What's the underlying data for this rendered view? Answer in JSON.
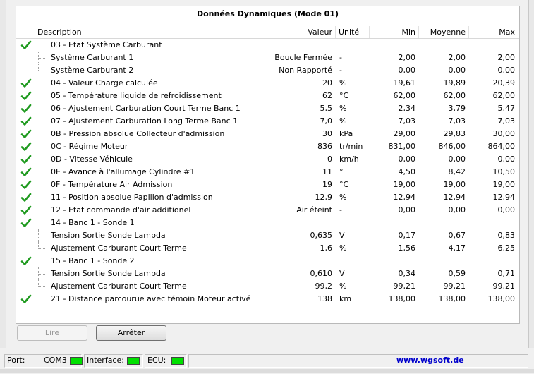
{
  "panel": {
    "title": "Données Dynamiques (Mode 01)"
  },
  "columns": {
    "description": "Description",
    "valeur": "Valeur",
    "unite": "Unité",
    "min": "Min",
    "moyenne": "Moyenne",
    "max": "Max"
  },
  "rows": [
    {
      "desc": "03 - Etat Système Carburant",
      "val": "",
      "unit": "",
      "min": "",
      "moy": "",
      "max": "",
      "check": true,
      "child": false
    },
    {
      "desc": "Système Carburant 1",
      "val": "Boucle Fermée",
      "unit": "-",
      "min": "2,00",
      "moy": "2,00",
      "max": "2,00",
      "check": false,
      "child": true
    },
    {
      "desc": "Système Carburant 2",
      "val": "Non Rapporté",
      "unit": "-",
      "min": "0,00",
      "moy": "0,00",
      "max": "0,00",
      "check": false,
      "child": true,
      "last": true
    },
    {
      "desc": "04 - Valeur Charge calculée",
      "val": "20",
      "unit": "%",
      "min": "19,61",
      "moy": "19,89",
      "max": "20,39",
      "check": true,
      "child": false
    },
    {
      "desc": "05 - Température liquide de refroidissement",
      "val": "62",
      "unit": "°C",
      "min": "62,00",
      "moy": "62,00",
      "max": "62,00",
      "check": true,
      "child": false
    },
    {
      "desc": "06 - Ajustement Carburation Court Terme Banc 1",
      "val": "5,5",
      "unit": "%",
      "min": "2,34",
      "moy": "3,79",
      "max": "5,47",
      "check": true,
      "child": false
    },
    {
      "desc": "07 - Ajustement Carburation Long Terme Banc 1",
      "val": "7,0",
      "unit": "%",
      "min": "7,03",
      "moy": "7,03",
      "max": "7,03",
      "check": true,
      "child": false
    },
    {
      "desc": "0B - Pression absolue Collecteur d'admission",
      "val": "30",
      "unit": "kPa",
      "min": "29,00",
      "moy": "29,83",
      "max": "30,00",
      "check": true,
      "child": false
    },
    {
      "desc": "0C - Régime Moteur",
      "val": "836",
      "unit": "tr/min",
      "min": "831,00",
      "moy": "846,00",
      "max": "864,00",
      "check": true,
      "child": false
    },
    {
      "desc": "0D - Vitesse Véhicule",
      "val": "0",
      "unit": "km/h",
      "min": "0,00",
      "moy": "0,00",
      "max": "0,00",
      "check": true,
      "child": false
    },
    {
      "desc": "0E - Avance à l'allumage Cylindre #1",
      "val": "11",
      "unit": "°",
      "min": "4,50",
      "moy": "8,42",
      "max": "10,50",
      "check": true,
      "child": false
    },
    {
      "desc": "0F - Température Air Admission",
      "val": "19",
      "unit": "°C",
      "min": "19,00",
      "moy": "19,00",
      "max": "19,00",
      "check": true,
      "child": false
    },
    {
      "desc": "11 - Position absolue Papillon d'admission",
      "val": "12,9",
      "unit": "%",
      "min": "12,94",
      "moy": "12,94",
      "max": "12,94",
      "check": true,
      "child": false
    },
    {
      "desc": "12 - Etat commande d'air additionel",
      "val": "Air éteint",
      "unit": "-",
      "min": "0,00",
      "moy": "0,00",
      "max": "0,00",
      "check": true,
      "child": false
    },
    {
      "desc": "14 - Banc 1 - Sonde 1",
      "val": "",
      "unit": "",
      "min": "",
      "moy": "",
      "max": "",
      "check": true,
      "child": false
    },
    {
      "desc": "Tension Sortie Sonde Lambda",
      "val": "0,635",
      "unit": "V",
      "min": "0,17",
      "moy": "0,67",
      "max": "0,83",
      "check": false,
      "child": true
    },
    {
      "desc": "Ajustement Carburant Court Terme",
      "val": "1,6",
      "unit": "%",
      "min": "1,56",
      "moy": "4,17",
      "max": "6,25",
      "check": false,
      "child": true,
      "last": true
    },
    {
      "desc": "15 - Banc 1 - Sonde 2",
      "val": "",
      "unit": "",
      "min": "",
      "moy": "",
      "max": "",
      "check": true,
      "child": false
    },
    {
      "desc": "Tension Sortie Sonde Lambda",
      "val": "0,610",
      "unit": "V",
      "min": "0,34",
      "moy": "0,59",
      "max": "0,71",
      "check": false,
      "child": true
    },
    {
      "desc": "Ajustement Carburant Court Terme",
      "val": "99,2",
      "unit": "%",
      "min": "99,21",
      "moy": "99,21",
      "max": "99,21",
      "check": false,
      "child": true,
      "last": true
    },
    {
      "desc": "21 - Distance parcourue avec témoin Moteur activé",
      "val": "138",
      "unit": "km",
      "min": "138,00",
      "moy": "138,00",
      "max": "138,00",
      "check": true,
      "child": false
    }
  ],
  "buttons": {
    "lire": "Lire",
    "arreter": "Arrêter"
  },
  "status": {
    "port_label": "Port:",
    "port_value": "COM3",
    "interface_label": "Interface:",
    "ecu_label": "ECU:",
    "website": "www.wgsoft.de",
    "led_color": "#00e000"
  },
  "colors": {
    "check": "#1f9a1f"
  }
}
